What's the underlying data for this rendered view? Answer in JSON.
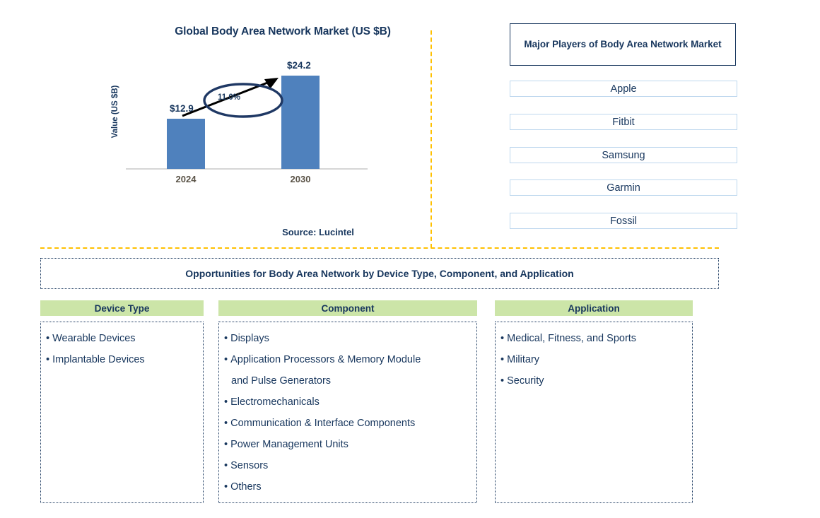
{
  "chart": {
    "title": "Global Body Area Network Market (US $B)",
    "y_axis_label": "Value (US $B)",
    "source_note": "Source: Lucintel",
    "cagr_label": "11.0%"
  },
  "chart_data": {
    "type": "bar",
    "title": "Global Body Area Network Market (US $B)",
    "categories": [
      "2024",
      "2030"
    ],
    "values": [
      12.9,
      24.2
    ],
    "data_labels": [
      "$12.9",
      "$24.2"
    ],
    "xlabel": "",
    "ylabel": "Value (US $B)",
    "ylim": [
      0,
      30
    ],
    "grid": false,
    "legend": "none",
    "annotations": [
      {
        "text": "11.0%",
        "type": "cagr-ellipse",
        "note": "arrow from 2024 bar to 2030 bar"
      }
    ],
    "series": [
      {
        "name": "Value (US $B)",
        "values": [
          12.9,
          24.2
        ],
        "color": "#4f81bd"
      }
    ],
    "source": "Source: Lucintel"
  },
  "players": {
    "header": "Major Players of Body Area Network Market",
    "items": [
      "Apple",
      "Fitbit",
      "Samsung",
      "Garmin",
      "Fossil"
    ]
  },
  "opportunities": {
    "banner": "Opportunities for Body Area Network by Device Type, Component, and Application",
    "columns": [
      {
        "header": "Device Type",
        "items": [
          "Wearable Devices",
          "Implantable Devices"
        ]
      },
      {
        "header": "Component",
        "items": [
          "Displays",
          "Application Processors & Memory Module",
          "and Pulse Generators",
          "Electromechanicals",
          "Communication & Interface Components",
          "Power Management Units",
          "Sensors",
          "Others"
        ]
      },
      {
        "header": "Application",
        "items": [
          "Medical, Fitness, and Sports",
          "Military",
          "Security"
        ]
      }
    ]
  },
  "colors": {
    "navy": "#17365d",
    "bar_blue": "#4f81bd",
    "header_green": "#cce5a8",
    "divider_gold": "#ffc000",
    "player_border": "#bdd7ee"
  }
}
